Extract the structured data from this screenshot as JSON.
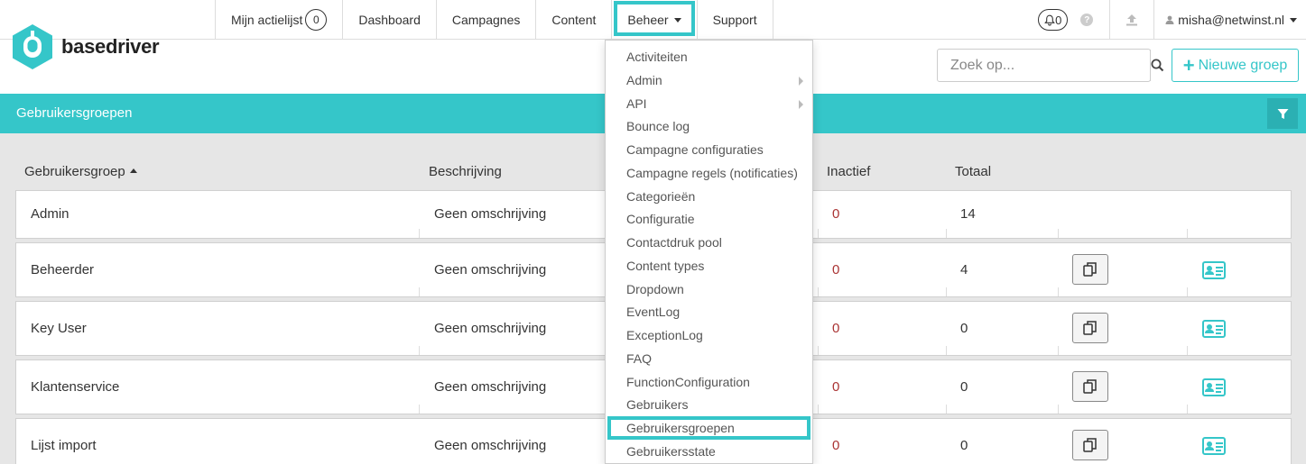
{
  "brand": {
    "name": "basedriver",
    "color": "#35c6c9"
  },
  "nav": {
    "actielijst_label": "Mijn actielijst",
    "actielijst_count": "0",
    "items": [
      "Dashboard",
      "Campagnes",
      "Content",
      "Beheer",
      "Support"
    ],
    "active": "Beheer"
  },
  "tools": {
    "notifications_count": "0",
    "user_email": "misha@netwinst.nl"
  },
  "search": {
    "placeholder": "Zoek op..."
  },
  "new_group_label": "Nieuwe groep",
  "section_title": "Gebruikersgroepen",
  "table": {
    "headers": {
      "group": "Gebruikersgroep",
      "description": "Beschrijving",
      "inactive": "Inactief",
      "total": "Totaal"
    },
    "rows": [
      {
        "name": "Admin",
        "description": "Geen omschrijving",
        "inactive": "0",
        "total": "14"
      },
      {
        "name": "Beheerder",
        "description": "Geen omschrijving",
        "inactive": "0",
        "total": "4"
      },
      {
        "name": "Key User",
        "description": "Geen omschrijving",
        "inactive": "0",
        "total": "0"
      },
      {
        "name": "Klantenservice",
        "description": "Geen omschrijving",
        "inactive": "0",
        "total": "0"
      },
      {
        "name": "Lijst import",
        "description": "Geen omschrijving",
        "inactive": "0",
        "total": "0"
      }
    ]
  },
  "dropdown": {
    "items": [
      "Activiteiten",
      "Admin",
      "API",
      "Bounce log",
      "Campagne configuraties",
      "Campagne regels (notificaties)",
      "Categorieën",
      "Configuratie",
      "Contactdruk pool",
      "Content types",
      "Dropdown",
      "EventLog",
      "ExceptionLog",
      "FAQ",
      "FunctionConfiguration",
      "Gebruikers",
      "Gebruikersgroepen",
      "Gebruikersstate"
    ],
    "submenu_items": [
      "Admin",
      "API"
    ],
    "highlighted": "Gebruikersgroepen"
  }
}
